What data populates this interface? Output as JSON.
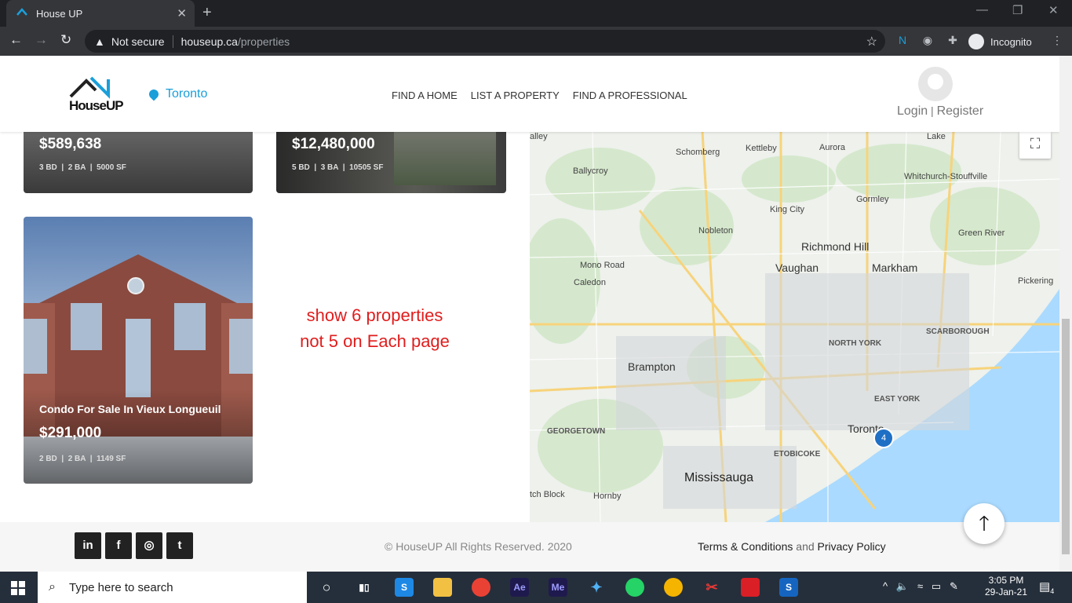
{
  "browser": {
    "tab_title": "House UP",
    "tab_close": "✕",
    "new_tab": "+",
    "security": "Not secure",
    "url_host": "houseup.ca",
    "url_path": "/properties",
    "profile": "Incognito"
  },
  "site": {
    "logo_text": "HouseUP",
    "city": "Toronto",
    "nav": [
      "FIND A HOME",
      "LIST A PROPERTY",
      "FIND A PROFESSIONAL"
    ],
    "login": "Login",
    "register": "Register"
  },
  "listings": [
    {
      "price": "$589,638",
      "bd": "3 BD",
      "ba": "2 BA",
      "sf": "5000 SF",
      "colors": [
        "#6b6b6b",
        "#2b2b2b"
      ]
    },
    {
      "price": "$12,480,000",
      "bd": "5 BD",
      "ba": "3 BA",
      "sf": "10505 SF",
      "colors": [
        "#4a4a4a",
        "#1d1d1d"
      ]
    },
    {
      "title": "Condo For Sale In Vieux Longueuil",
      "price": "$291,000",
      "bd": "2 BD",
      "ba": "2 BA",
      "sf": "1149 SF"
    }
  ],
  "annotation": {
    "line1": "show 6 properties",
    "line2": "not 5 on Each page"
  },
  "map": {
    "labels": [
      {
        "text": "Schomberg",
        "cls": ""
      },
      {
        "text": "Kettleby",
        "cls": ""
      },
      {
        "text": "Aurora",
        "cls": ""
      },
      {
        "text": "Whitchurch-Stouffville",
        "cls": ""
      },
      {
        "text": "Ballycroy",
        "cls": ""
      },
      {
        "text": "Gormley",
        "cls": ""
      },
      {
        "text": "King City",
        "cls": ""
      },
      {
        "text": "Nobleton",
        "cls": ""
      },
      {
        "text": "Green River",
        "cls": ""
      },
      {
        "text": "Richmond Hill",
        "cls": "big"
      },
      {
        "text": "Mono Road",
        "cls": ""
      },
      {
        "text": "Vaughan",
        "cls": "big"
      },
      {
        "text": "Markham",
        "cls": "big"
      },
      {
        "text": "Pickering",
        "cls": ""
      },
      {
        "text": "Caledon",
        "cls": ""
      },
      {
        "text": "NORTH YORK",
        "cls": "caps"
      },
      {
        "text": "SCARBOROUGH",
        "cls": "caps"
      },
      {
        "text": "Brampton",
        "cls": "big"
      },
      {
        "text": "EAST YORK",
        "cls": "caps"
      },
      {
        "text": "GEORGETOWN",
        "cls": "caps"
      },
      {
        "text": "Toronto",
        "cls": "big"
      },
      {
        "text": "ETOBICOKE",
        "cls": "caps"
      },
      {
        "text": "Mississauga",
        "cls": "bold"
      },
      {
        "text": "tch Block",
        "cls": ""
      },
      {
        "text": "Hornby",
        "cls": ""
      },
      {
        "text": "Lake",
        "cls": ""
      },
      {
        "text": "alley",
        "cls": ""
      }
    ],
    "cluster_count": "4",
    "fullscreen_icon": "⛶"
  },
  "footer": {
    "social": [
      "in",
      "f",
      "◎",
      "t"
    ],
    "copyright": "© HouseUP All Rights Reserved. 2020",
    "terms": "Terms & Conditions",
    "and": "and",
    "privacy": "Privacy Policy"
  },
  "back_to_top_icon": "🡑",
  "taskbar": {
    "search_placeholder": "Type here to search",
    "time": "3:05 PM",
    "date": "29-Jan-21",
    "notifications": "4"
  }
}
